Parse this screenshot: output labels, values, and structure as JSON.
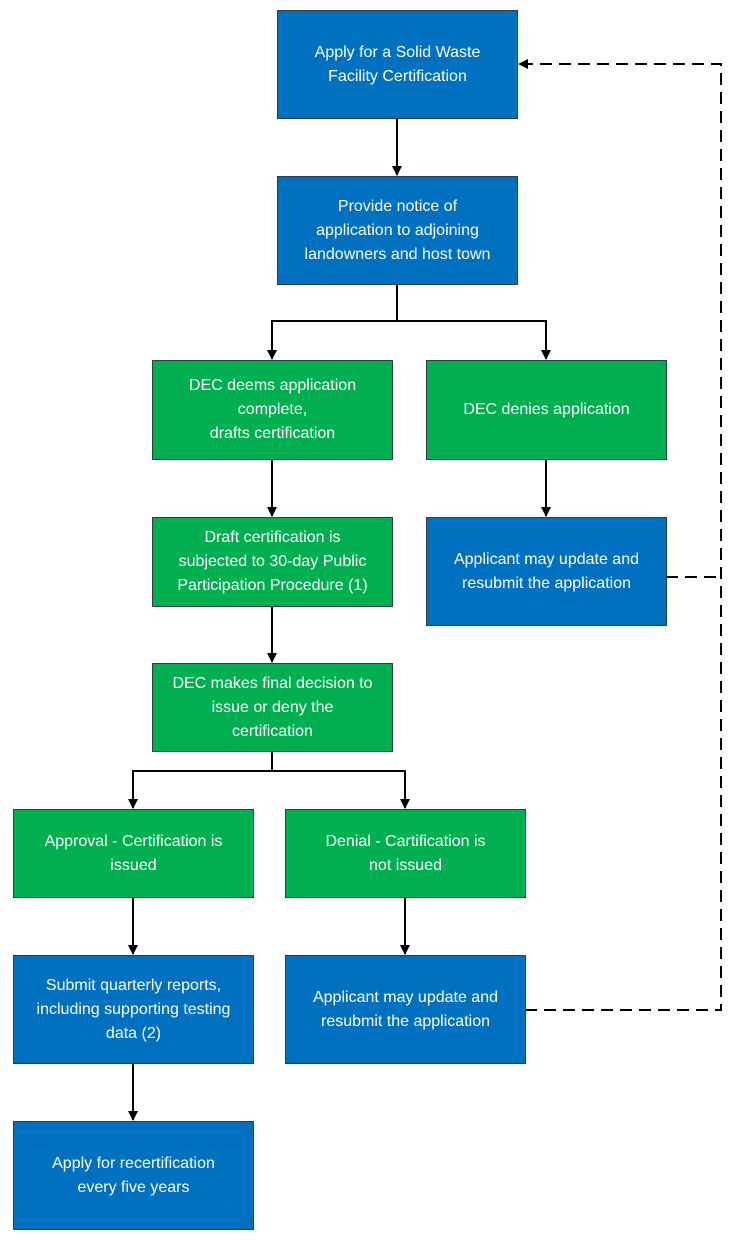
{
  "colors": {
    "blue": "#0070C0",
    "green": "#00B050",
    "connector": "#000000"
  },
  "nodes": {
    "apply": "Apply for a Solid Waste\nFacility Certification",
    "notice": "Provide notice of\napplication to adjoining\nlandowners and host town",
    "complete": "DEC deems application\ncomplete,\ndrafts certification",
    "denies": "DEC denies application",
    "draft": "Draft certification is\nsubjected to 30-day Public\nParticipation Procedure (1)",
    "resubmit1": "Applicant may update and\nresubmit the application",
    "final": "DEC makes final decision to\nissue or deny the\ncertification",
    "approval": "Approval - Certification is\nissued",
    "denial": "Denial - Cartification is\nnot  issued",
    "quarterly": "Submit quarterly reports,\nincluding supporting testing\ndata (2)",
    "resubmit2": "Applicant may update and\nresubmit the application",
    "recert": "Apply for recertification\nevery five years"
  }
}
